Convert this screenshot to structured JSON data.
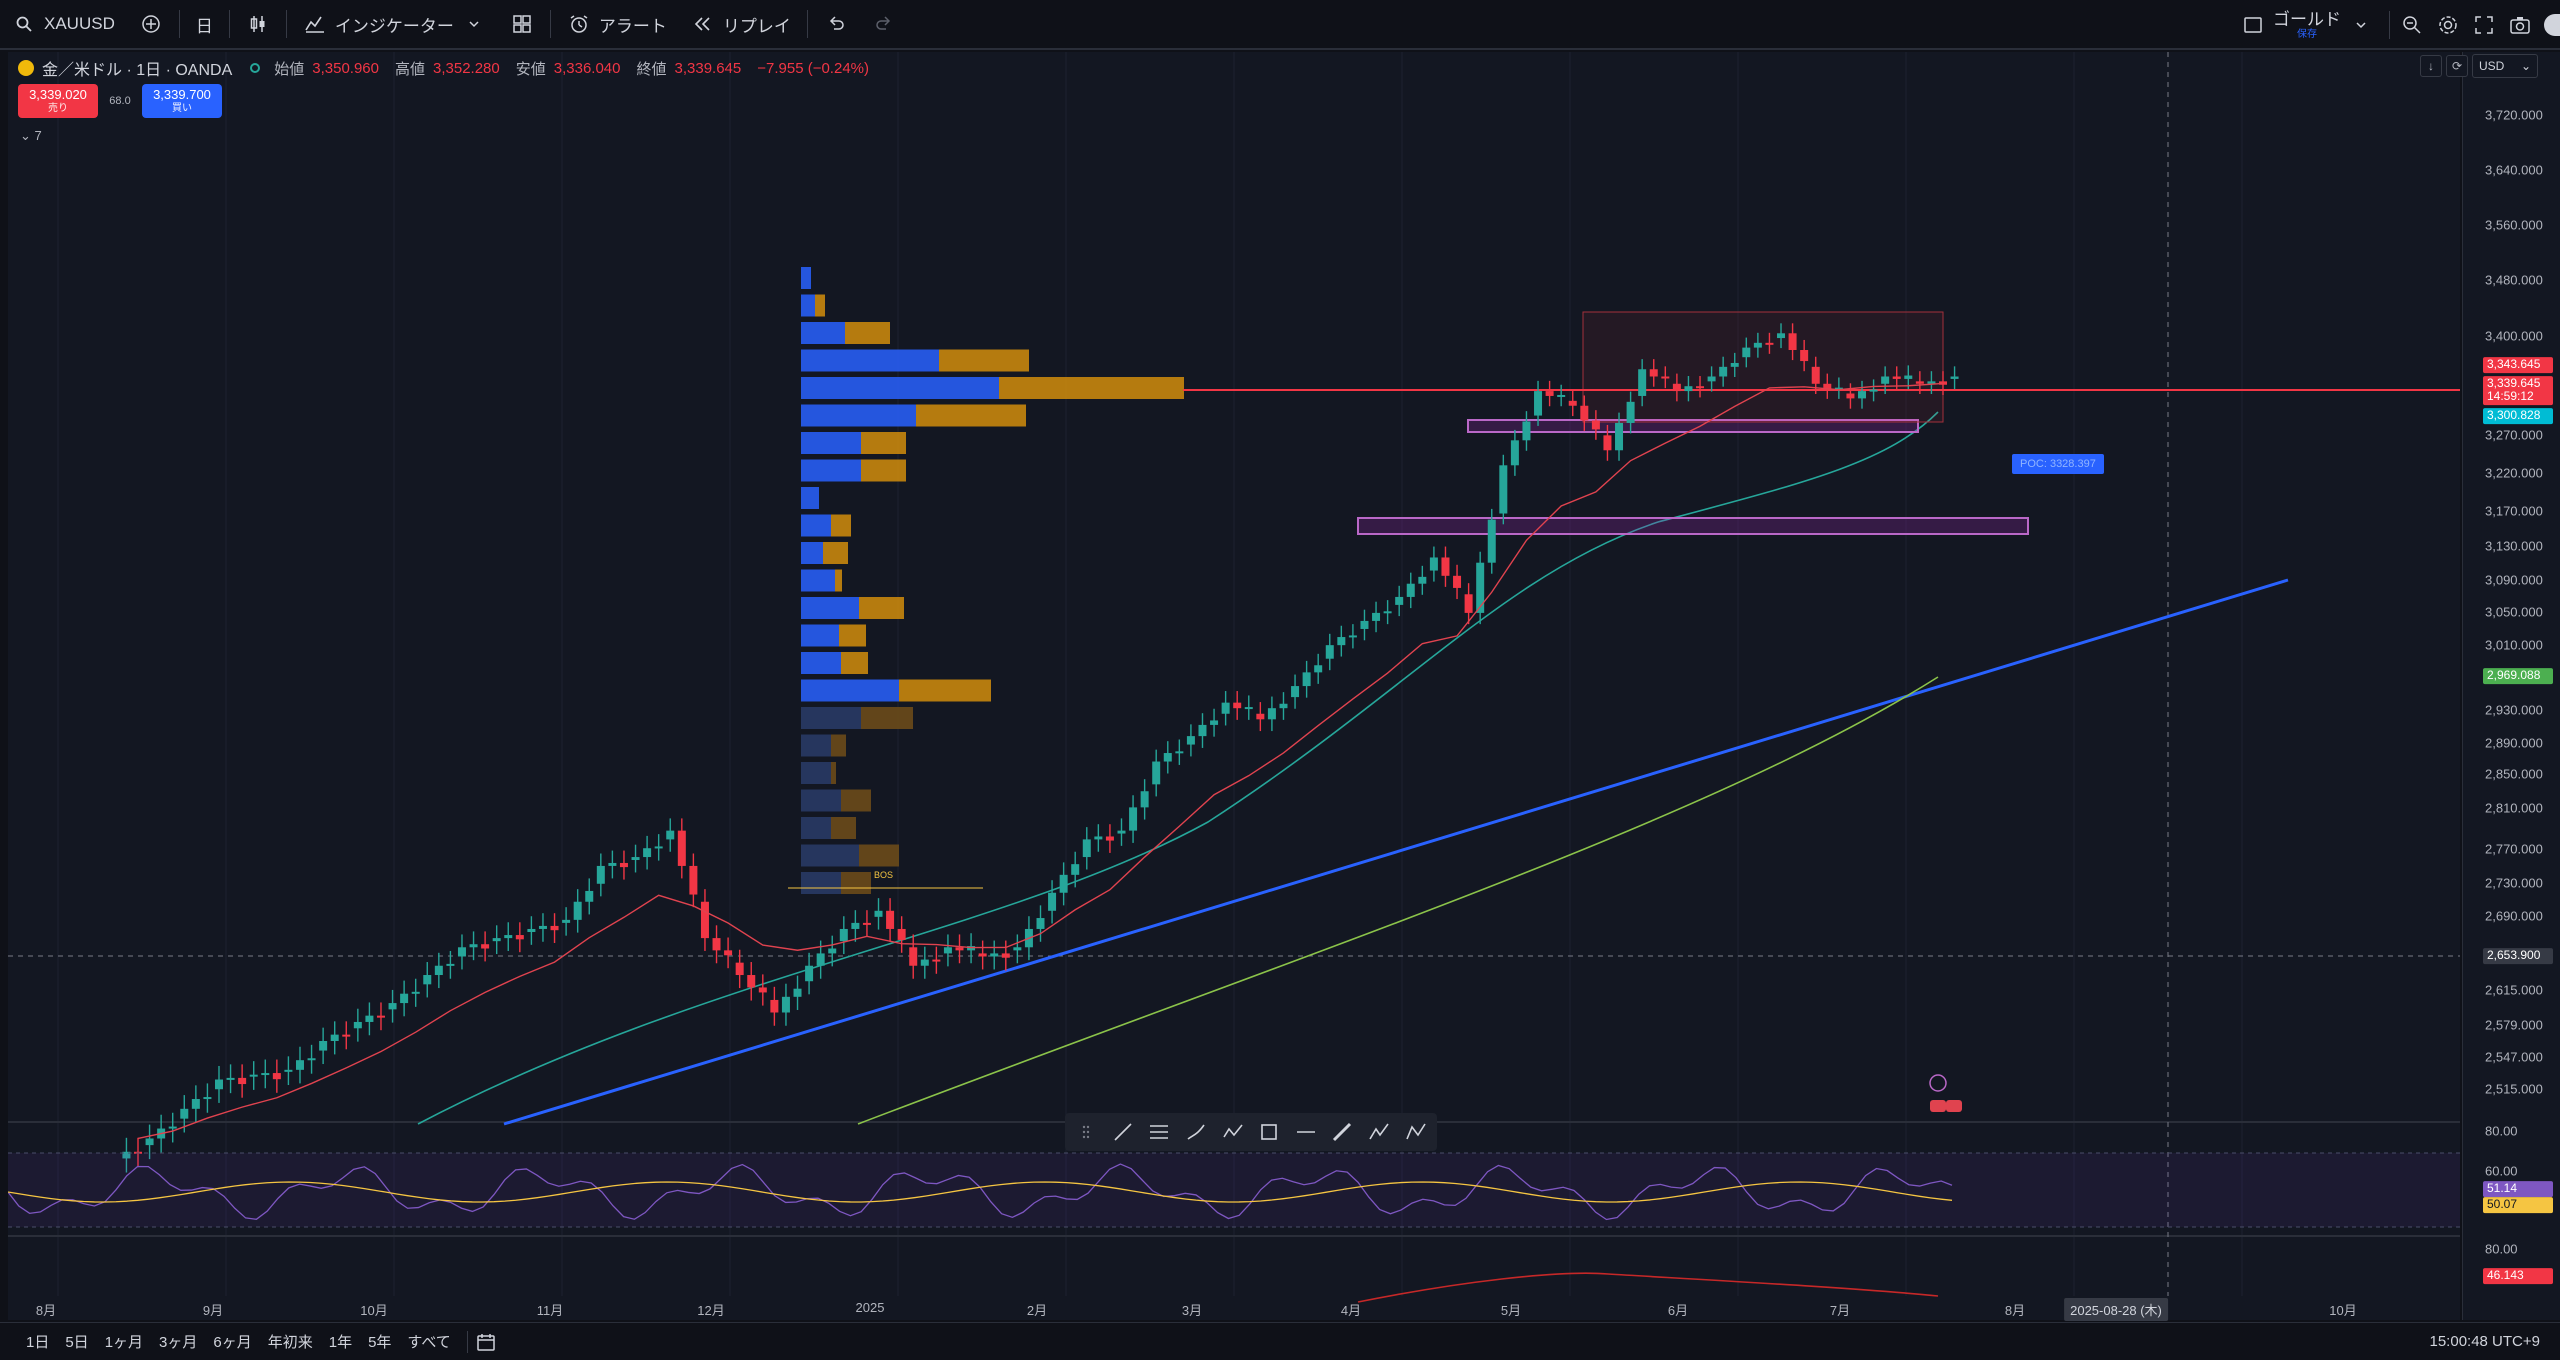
{
  "toolbar": {
    "symbol": "XAUUSD",
    "interval": "日",
    "indicators_label": "インジケーター",
    "alert_label": "アラート",
    "replay_label": "リプレイ",
    "layout_name": "ゴールド",
    "layout_saved": "保存",
    "icons": [
      "search-icon",
      "plus-circle-icon",
      "candle-style-icon",
      "indicators-icon",
      "templates-icon",
      "alert-icon",
      "replay-icon",
      "undo-icon",
      "redo-icon",
      "layout-icon",
      "zoom-icon",
      "settings-icon",
      "fullscreen-icon",
      "snapshot-icon"
    ]
  },
  "legend": {
    "symbol_name": "金／米ドル · 1日 · OANDA",
    "open_label": "始値",
    "open": "3,350.960",
    "high_label": "高値",
    "high": "3,352.280",
    "low_label": "安値",
    "low": "3,336.040",
    "close_label": "終値",
    "close": "3,339.645",
    "change": "−7.955 (−0.24%)",
    "sell_price": "3,339.020",
    "sell_label": "売り",
    "spread": "68.0",
    "buy_price": "3,339.700",
    "buy_label": "買い",
    "indicator_count": "7"
  },
  "price_scale": {
    "currency": "USD",
    "ticks": [
      "3,720.000",
      "3,640.000",
      "3,560.000",
      "3,480.000",
      "3,400.000",
      "3,270.000",
      "3,220.000",
      "3,170.000",
      "3,130.000",
      "3,090.000",
      "3,050.000",
      "3,010.000",
      "2,930.000",
      "2,890.000",
      "2,850.000",
      "2,810.000",
      "2,770.000",
      "2,730.000",
      "2,690.000",
      "2,615.000",
      "2,579.000",
      "2,547.000",
      "2,515.000"
    ],
    "labels": {
      "price_a": "3,343.645",
      "price_b": "3,339.645",
      "countdown": "14:59:12",
      "ema": "3,300.828",
      "ma_green": "2,969.088",
      "crosshair": "2,653.900"
    },
    "rsi_ticks": [
      "80.00",
      "60.00"
    ],
    "rsi_labels": {
      "rsi": "51.14",
      "rsi_ma": "50.07"
    },
    "osc_ticks": [
      "80.00"
    ],
    "osc_label": "46.143"
  },
  "annotations": {
    "poc": "POC: 3328.397",
    "bos": "BOS"
  },
  "time_axis": {
    "ticks": [
      "8月",
      "9月",
      "10月",
      "11月",
      "12月",
      "2025",
      "2月",
      "3月",
      "4月",
      "5月",
      "6月",
      "7月",
      "8月",
      "10月"
    ],
    "crosshair_date": "2025-08-28 (木)"
  },
  "bottom": {
    "ranges": [
      "1日",
      "5日",
      "1ヶ月",
      "3ヶ月",
      "6ヶ月",
      "年初来",
      "1年",
      "5年",
      "すべて"
    ],
    "clock": "15:00:48 UTC+9"
  },
  "colors": {
    "bg": "#131722",
    "up": "#26a69a",
    "down": "#f23645",
    "blue": "#2962ff",
    "vp_orange": "#c8860d",
    "ma_green": "#8bc34a",
    "purple": "#9c27b0"
  },
  "chart_data": {
    "type": "candlestick",
    "title": "金／米ドル · 1日 · OANDA",
    "ylim": [
      2490,
      3760
    ],
    "x_range": [
      "2024-08",
      "2025-10"
    ],
    "price_line": 3339.645,
    "poc": 3328.397,
    "zones": [
      {
        "name": "support_upper",
        "from": 3280,
        "to": 3300
      },
      {
        "name": "support_lower",
        "from": 3145,
        "to": 3160
      }
    ],
    "closes_weekly": [
      2440,
      2470,
      2500,
      2505,
      2510,
      2540,
      2560,
      2580,
      2610,
      2640,
      2650,
      2660,
      2670,
      2730,
      2740,
      2770,
      2650,
      2610,
      2570,
      2620,
      2660,
      2680,
      2620,
      2640,
      2630,
      2640,
      2700,
      2760,
      2770,
      2850,
      2880,
      2920,
      2900,
      2940,
      2990,
      3020,
      3050,
      3100,
      3030,
      3220,
      3320,
      3300,
      3240,
      3350,
      3320,
      3340,
      3380,
      3400,
      3330,
      3310,
      3340,
      3330,
      3340
    ],
    "rsi": {
      "last": 51.14,
      "ma": 50.07,
      "ylim": [
        0,
        100
      ]
    },
    "oscillator": {
      "last": 46.143
    }
  }
}
